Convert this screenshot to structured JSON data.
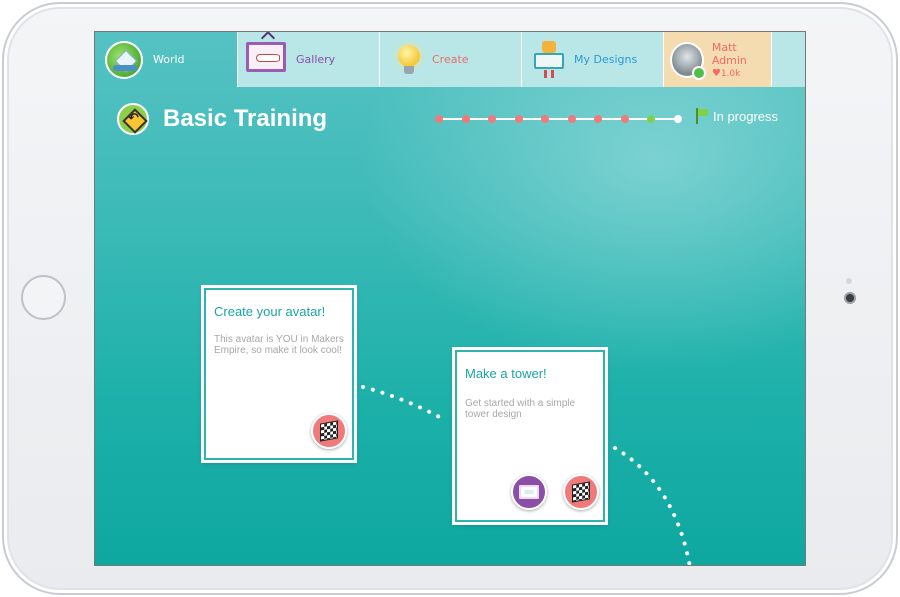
{
  "tabs": {
    "world": {
      "label": "World",
      "icon": "globe-icon"
    },
    "gallery": {
      "label": "Gallery",
      "icon": "gallery-frame-icon"
    },
    "create": {
      "label": "Create",
      "icon": "lightbulb-icon"
    },
    "my_designs": {
      "label": "My Designs",
      "icon": "robot-board-icon"
    },
    "profile": {
      "name": "Matt Admin",
      "likes": "1.0k",
      "icon": "avatar-photo-icon"
    }
  },
  "header": {
    "title": "Basic Training",
    "icon": "road-sign-icon"
  },
  "progress": {
    "status": "In progress",
    "steps_total": 10,
    "current_step": 9
  },
  "missions": [
    {
      "title": "Create your avatar!",
      "description": "This avatar is YOU in Makers Empire, so make it look cool!"
    },
    {
      "title": "Make a tower!",
      "description": "Get started with a simple tower design"
    }
  ],
  "colors": {
    "screen_bg": "#3cbab8",
    "tab_bg": "#b9e6e6",
    "profile_tab_bg": "#f5dcb0",
    "gallery_accent": "#8a4fa6",
    "create_accent": "#f06a6a",
    "designs_accent": "#2a9bd4",
    "card_title": "#1aa5a2",
    "card_border": "#2fb3aa",
    "progress_todo": "#f07a7a",
    "progress_current": "#7fd14a"
  }
}
